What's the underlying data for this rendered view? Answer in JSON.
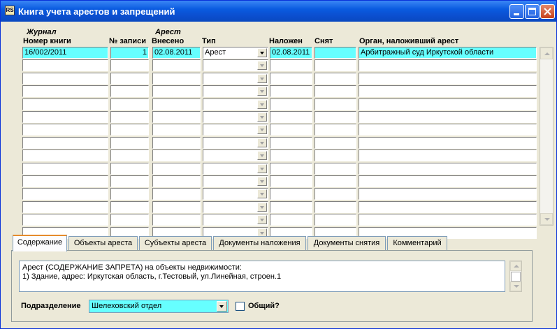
{
  "window": {
    "title": "Книга учета арестов и запрещений"
  },
  "headers": {
    "group_journal": "Журнал",
    "group_arrest": "Арест",
    "book_number": "Номер книги",
    "record_no": "№ записи",
    "entered": "Внесено",
    "type": "Тип",
    "imposed": "Наложен",
    "removed": "Снят",
    "authority": "Орган, наложивший арест"
  },
  "rows": [
    {
      "book": "16/002/2011",
      "record": "1",
      "entered": "02.08.2011",
      "type": "Арест",
      "imposed": "02.08.2011",
      "removed": "",
      "authority": "Арбитражный суд Иркутской области"
    }
  ],
  "empty_row_count": 14,
  "tabs": [
    {
      "label": "Содержание"
    },
    {
      "label": "Объекты ареста"
    },
    {
      "label": "Субъекты ареста"
    },
    {
      "label": "Документы наложения"
    },
    {
      "label": "Документы снятия"
    },
    {
      "label": "Комментарий"
    }
  ],
  "content": {
    "line1": "Арест (СОДЕРЖАНИЕ ЗАПРЕТА)  на объекты недвижимости:",
    "line2": "1) Здание, адрес: Иркутская область, г.Тестовый, ул.Линейная, строен.1"
  },
  "department": {
    "label": "Подразделение",
    "value": "Шелеховский отдел"
  },
  "general": {
    "label": "Общий?",
    "checked": false
  },
  "colors": {
    "highlight": "#66ffff",
    "titlebar": "#0a5be0"
  }
}
